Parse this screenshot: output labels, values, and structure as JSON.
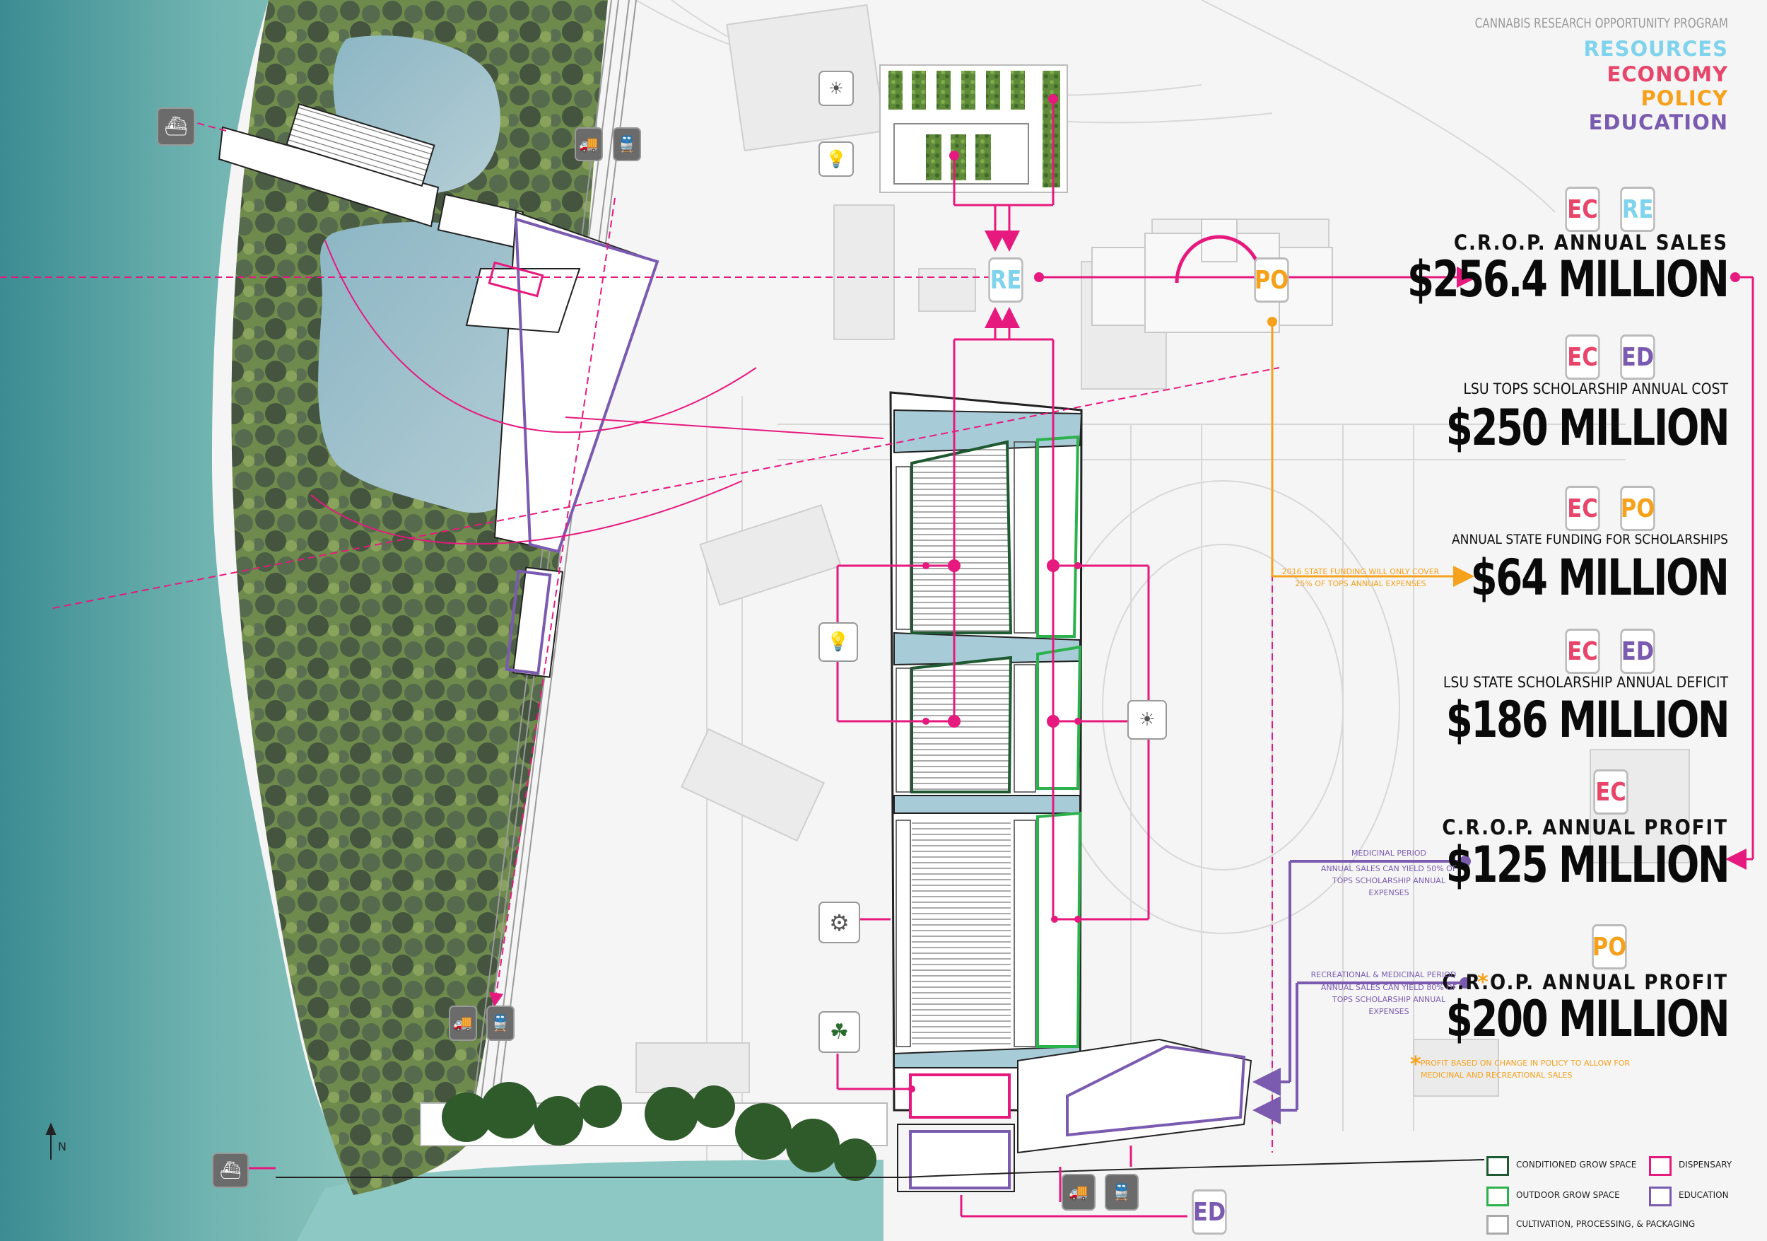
{
  "header": {
    "program": "CANNABIS RESEARCH OPPORTUNITY PROGRAM",
    "resources": "RESOURCES",
    "economy": "ECONOMY",
    "policy": "POLICY",
    "education": "EDUCATION"
  },
  "colors": {
    "resources": "#7fd3ec",
    "economy": "#e8456b",
    "policy": "#f5a11c",
    "education": "#7a5bb0",
    "magenta": "#e6197e",
    "conditioned_grow": "#1f5a32",
    "outdoor_grow": "#2bb24c",
    "dispensary": "#e6197e",
    "cultivation": "#aaaaaa"
  },
  "tags": {
    "re": "RE",
    "ec": "EC",
    "ed": "ED",
    "po": "PO"
  },
  "stats": [
    {
      "tags": [
        "EC",
        "RE"
      ],
      "label": "C.R.O.P. ANNUAL SALES",
      "value": "$256.4 MILLION"
    },
    {
      "tags": [
        "EC",
        "ED"
      ],
      "label": "LSU TOPS SCHOLARSHIP ANNUAL COST",
      "value": "$250 MILLION"
    },
    {
      "tags": [
        "EC",
        "PO"
      ],
      "label": "ANNUAL STATE FUNDING FOR SCHOLARSHIPS",
      "value": "$64 MILLION"
    },
    {
      "tags": [
        "EC",
        "ED"
      ],
      "label": "LSU STATE SCHOLARSHIP ANNUAL DEFICIT",
      "value": "$186 MILLION"
    },
    {
      "tags": [
        "EC"
      ],
      "label": "C.R.O.P.  ANNUAL PROFIT",
      "value": "$125 MILLION"
    },
    {
      "tags": [
        "PO"
      ],
      "label": "C.R.O.P. ANNUAL PROFIT",
      "value": "$200 MILLION"
    }
  ],
  "notes": {
    "state_funding": "2016 STATE FUNDING WILL ONLY COVER 25% OF TOPS ANNUAL EXPENSES",
    "medicinal_title": "MEDICINAL PERIOD",
    "medicinal_body": "ANNUAL SALES CAN YIELD 50% OF TOPS SCHOLARSHIP ANNUAL EXPENSES",
    "recreational_title": "RECREATIONAL & MEDICINAL PERIOD",
    "recreational_body": "ANNUAL SALES CAN YIELD 80% OF TOPS SCHOLARSHIP ANNUAL EXPENSES",
    "asterisk": "*",
    "profit_footnote": "PROFIT BASED ON CHANGE IN POLICY TO ALLOW FOR MEDICINAL AND RECREATIONAL SALES"
  },
  "legend": {
    "conditioned": "CONDITIONED GROW SPACE",
    "outdoor": "OUTDOOR GROW SPACE",
    "cultivation": "CULTIVATION, PROCESSING, & PACKAGING",
    "dispensary": "DISPENSARY",
    "education": "EDUCATION"
  },
  "north_label": "N",
  "icons": [
    "ship-icon",
    "truck-icon",
    "train-icon",
    "lightbulb-icon",
    "sun-icon",
    "cannabis-leaf-icon",
    "gears-icon"
  ]
}
